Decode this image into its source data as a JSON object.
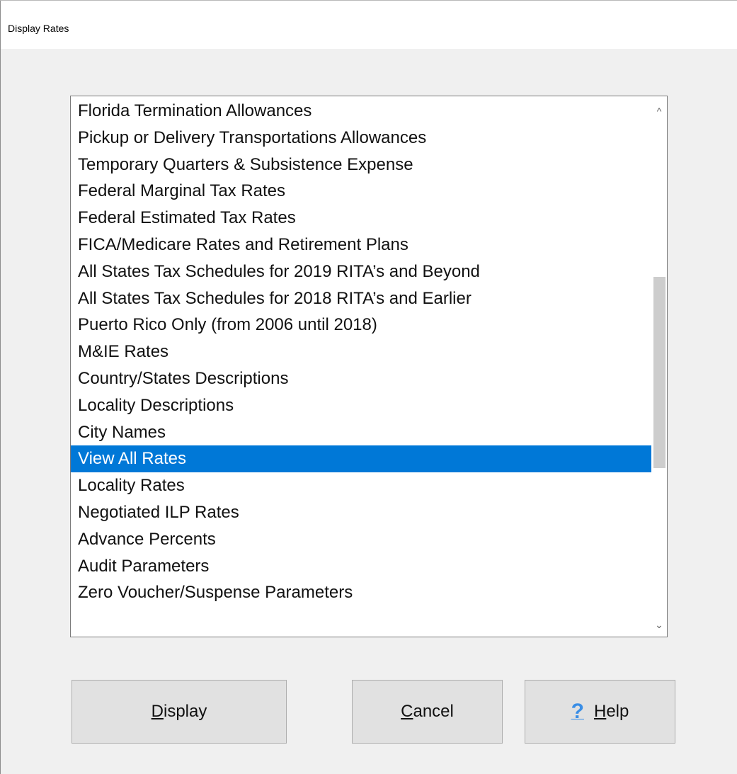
{
  "window": {
    "title": "Display Rates"
  },
  "list": {
    "items": [
      "Florida Termination Allowances",
      "Pickup or Delivery Transportations Allowances",
      "Temporary Quarters & Subsistence Expense",
      "Federal Marginal Tax Rates",
      "Federal Estimated Tax Rates",
      "FICA/Medicare Rates and Retirement Plans",
      "All States Tax Schedules for 2019 RITA’s and Beyond",
      "All States Tax Schedules for 2018 RITA’s and Earlier",
      "Puerto Rico Only (from 2006 until 2018)",
      "M&IE Rates",
      "Country/States Descriptions",
      "Locality Descriptions",
      "City Names",
      "View All Rates",
      "Locality Rates",
      "Negotiated ILP Rates",
      "Advance Percents",
      "Audit Parameters",
      "Zero Voucher/Suspense Parameters"
    ],
    "selected_index": 13,
    "scroll_up_glyph": "^",
    "scroll_down_glyph": "⌄"
  },
  "buttons": {
    "display_label": "Display",
    "cancel_label": "Cancel",
    "help_label": "Help",
    "help_icon_glyph": "?"
  },
  "colors": {
    "selection": "#0078d7",
    "help_icon": "#3a8ee6"
  }
}
